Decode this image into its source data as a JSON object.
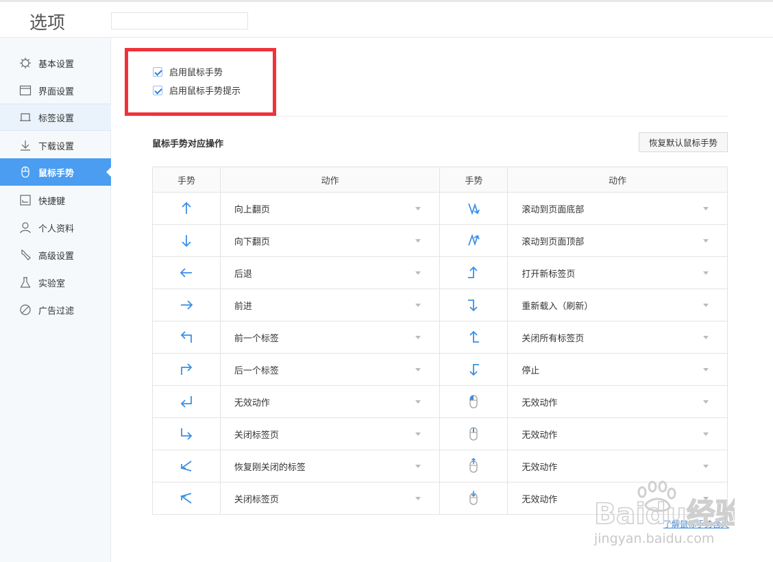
{
  "header": {
    "title": "选项",
    "search_value": ""
  },
  "sidebar": {
    "items": [
      {
        "label": "基本设置",
        "icon": "gear-icon"
      },
      {
        "label": "界面设置",
        "icon": "window-icon"
      },
      {
        "label": "标签设置",
        "icon": "tab-icon"
      },
      {
        "label": "下载设置",
        "icon": "download-icon"
      },
      {
        "label": "鼠标手势",
        "icon": "mouse-icon"
      },
      {
        "label": "快捷键",
        "icon": "keyboard-icon"
      },
      {
        "label": "个人资料",
        "icon": "user-icon"
      },
      {
        "label": "高级设置",
        "icon": "wrench-icon"
      },
      {
        "label": "实验室",
        "icon": "flask-icon"
      },
      {
        "label": "广告过滤",
        "icon": "block-icon"
      }
    ],
    "active_index": 4
  },
  "options": {
    "enable_gesture": {
      "label": "启用鼠标手势",
      "checked": true
    },
    "enable_gesture_hint": {
      "label": "启用鼠标手势提示",
      "checked": true
    }
  },
  "gestures": {
    "section_title": "鼠标手势对应操作",
    "reset_label": "恢复默认鼠标手势",
    "headers": {
      "gesture": "手势",
      "action": "动作"
    },
    "rows": [
      {
        "left_icon": "arrow-up-icon",
        "left_action": "向上翻页",
        "right_icon": "zigzag-down-icon",
        "right_action": "滚动到页面底部"
      },
      {
        "left_icon": "arrow-down-icon",
        "left_action": "向下翻页",
        "right_icon": "zigzag-up-icon",
        "right_action": "滚动到页面顶部"
      },
      {
        "left_icon": "arrow-left-icon",
        "left_action": "后退",
        "right_icon": "right-then-up-icon",
        "right_action": "打开新标签页"
      },
      {
        "left_icon": "arrow-right-icon",
        "left_action": "前进",
        "right_icon": "right-then-down-icon",
        "right_action": "重新载入（刷新）"
      },
      {
        "left_icon": "up-then-left-icon",
        "left_action": "前一个标签",
        "right_icon": "left-then-up-icon",
        "right_action": "关闭所有标签页"
      },
      {
        "left_icon": "up-then-right-icon",
        "left_action": "后一个标签",
        "right_icon": "left-then-down-icon",
        "right_action": "停止"
      },
      {
        "left_icon": "down-then-left-icon",
        "left_action": "无效动作",
        "right_icon": "mouse-left-click-icon",
        "right_action": "无效动作"
      },
      {
        "left_icon": "down-then-right-icon",
        "left_action": "关闭标签页",
        "right_icon": "mouse-middle-click-icon",
        "right_action": "无效动作"
      },
      {
        "left_icon": "left-diagonal-up-icon",
        "left_action": "恢复刚关闭的标签",
        "right_icon": "mouse-scroll-up-icon",
        "right_action": "无效动作"
      },
      {
        "left_icon": "left-diagonal-down-icon",
        "left_action": "关闭标签页",
        "right_icon": "mouse-scroll-down-icon",
        "right_action": "无效动作"
      }
    ],
    "learn_link": "了解鼠标手势含义"
  },
  "watermark": {
    "text": "Baidu经验",
    "url_text": "jingyan.baidu.com"
  },
  "colors": {
    "accent": "#4a9df0",
    "highlight_border": "#f0323a",
    "icon": "#3a8ee6"
  }
}
